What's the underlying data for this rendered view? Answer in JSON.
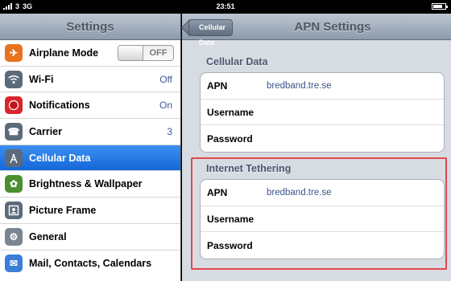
{
  "status_bar": {
    "carrier": "3",
    "network": "3G",
    "time": "23:51",
    "battery_fraction": 0.75
  },
  "sidebar": {
    "title": "Settings",
    "items": [
      {
        "label": "Airplane Mode",
        "toggle": "OFF",
        "icon": "airplane-icon",
        "color": "#e8731f"
      },
      {
        "label": "Wi-Fi",
        "value": "Off",
        "icon": "wifi-icon",
        "color": "#5b6b7c"
      },
      {
        "label": "Notifications",
        "value": "On",
        "icon": "notifications-icon",
        "color": "#d8262b"
      },
      {
        "label": "Carrier",
        "value": "3",
        "icon": "carrier-phone-icon",
        "color": "#5b6b7c"
      },
      {
        "label": "Cellular Data",
        "icon": "cellular-antenna-icon",
        "color": "#5b6b7c"
      },
      {
        "label": "Brightness & Wallpaper",
        "icon": "brightness-icon",
        "color": "#4a8f2e"
      },
      {
        "label": "Picture Frame",
        "icon": "picture-frame-icon",
        "color": "#5b6b7c"
      },
      {
        "label": "General",
        "icon": "gear-icon",
        "color": "#7b8590"
      },
      {
        "label": "Mail, Contacts, Calendars",
        "icon": "mail-icon",
        "color": "#3b7dd8"
      }
    ],
    "selected_index": 4
  },
  "detail": {
    "back_label": "Cellular Data",
    "title": "APN Settings",
    "sections": [
      {
        "header": "Cellular Data",
        "rows": [
          {
            "label": "APN",
            "value": "bredband.tre.se"
          },
          {
            "label": "Username",
            "value": ""
          },
          {
            "label": "Password",
            "value": ""
          }
        ]
      },
      {
        "header": "Internet Tethering",
        "rows": [
          {
            "label": "APN",
            "value": "bredband.tre.se"
          },
          {
            "label": "Username",
            "value": ""
          },
          {
            "label": "Password",
            "value": ""
          }
        ]
      }
    ]
  },
  "colors": {
    "selected": "#1a6fdc",
    "highlight_box": "#e0474c",
    "value_text": "#385487"
  }
}
